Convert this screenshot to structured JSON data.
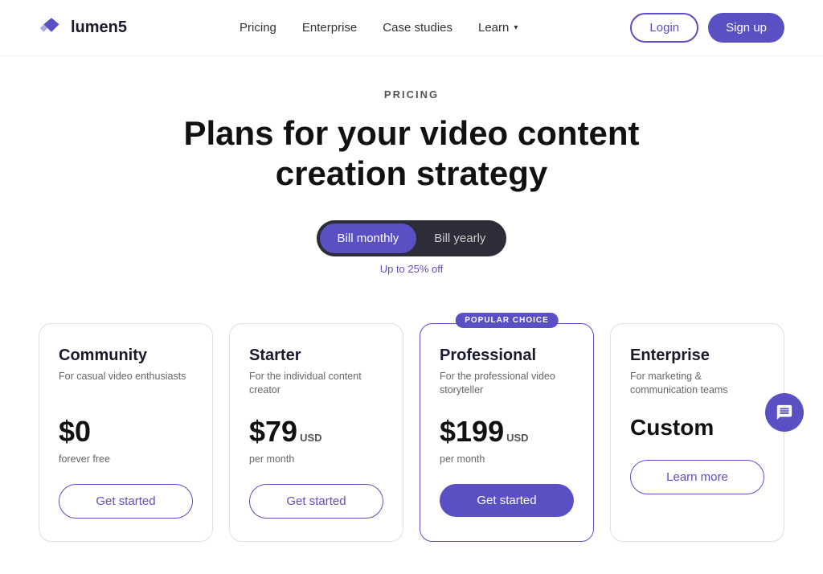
{
  "nav": {
    "logo_text": "lumen5",
    "links": [
      {
        "label": "Pricing",
        "id": "pricing"
      },
      {
        "label": "Enterprise",
        "id": "enterprise"
      },
      {
        "label": "Case studies",
        "id": "case-studies"
      },
      {
        "label": "Learn",
        "id": "learn"
      }
    ],
    "login_label": "Login",
    "signup_label": "Sign up"
  },
  "hero": {
    "section_label": "PRICING",
    "title": "Plans for your video content creation strategy"
  },
  "billing_toggle": {
    "monthly_label": "Bill monthly",
    "yearly_label": "Bill yearly",
    "yearly_note": "Up to 25% off",
    "active": "monthly"
  },
  "plans": [
    {
      "id": "community",
      "name": "Community",
      "desc": "For casual video enthusiasts",
      "price": "$0",
      "price_suffix": "",
      "period": "forever free",
      "btn_label": "Get started",
      "btn_type": "outline",
      "popular": false
    },
    {
      "id": "starter",
      "name": "Starter",
      "desc": "For the individual content creator",
      "price": "$79",
      "price_suffix": "USD",
      "period": "per month",
      "btn_label": "Get started",
      "btn_type": "outline",
      "popular": false
    },
    {
      "id": "professional",
      "name": "Professional",
      "desc": "For the professional video storyteller",
      "price": "$199",
      "price_suffix": "USD",
      "period": "per month",
      "btn_label": "Get started",
      "btn_type": "filled",
      "popular": true,
      "popular_label": "POPULAR CHOICE"
    },
    {
      "id": "enterprise",
      "name": "Enterprise",
      "desc": "For marketing & communication teams",
      "price": "Custom",
      "price_suffix": "",
      "period": "",
      "btn_label": "Learn more",
      "btn_type": "outline",
      "popular": false
    }
  ],
  "chat": {
    "icon": "💬"
  }
}
